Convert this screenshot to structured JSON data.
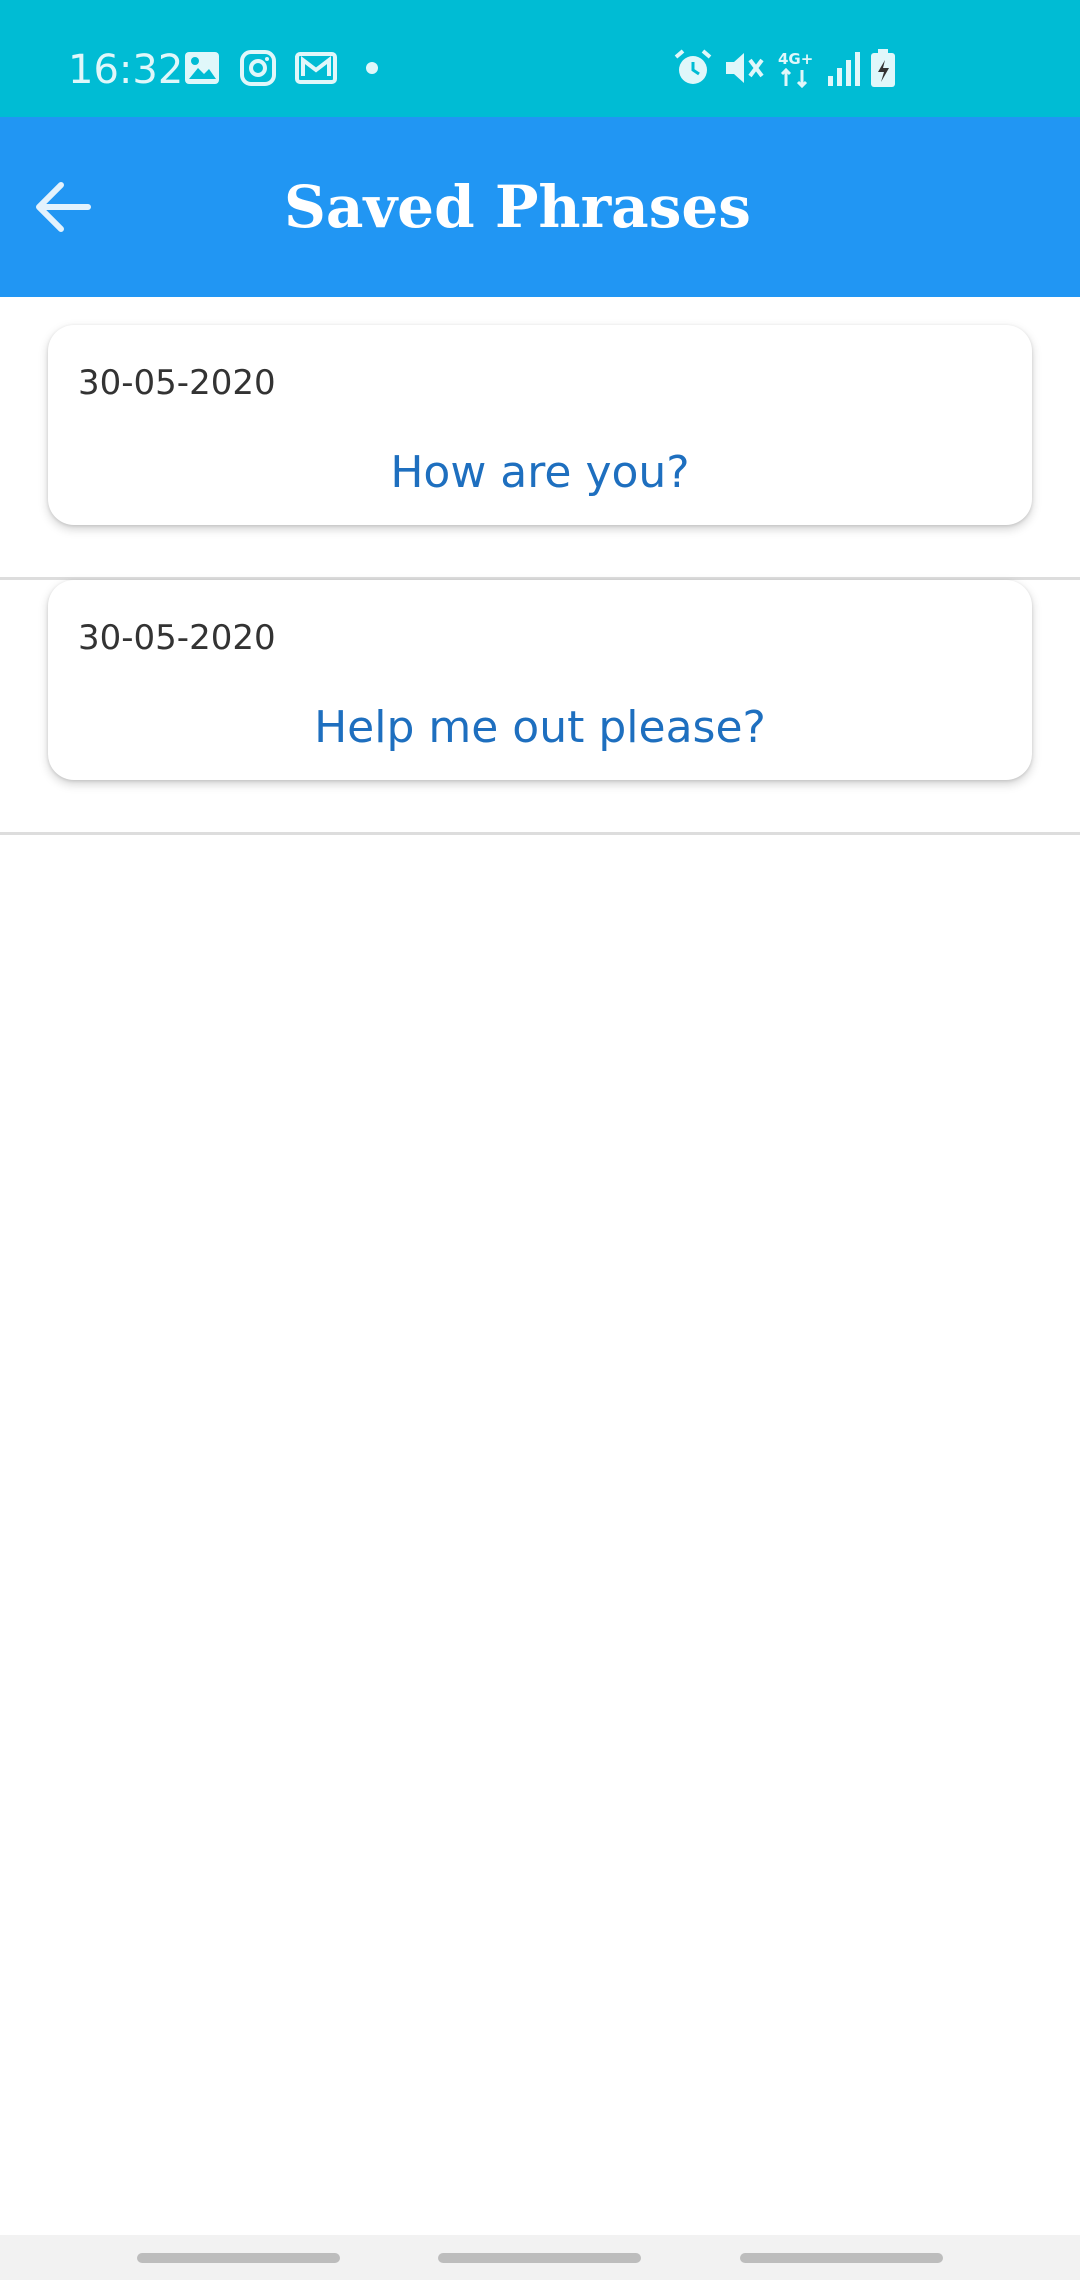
{
  "status_bar": {
    "time": "16:32",
    "left_icons": [
      "gallery-icon",
      "instagram-icon",
      "mail-icon",
      "dot-icon"
    ],
    "right_icons": [
      "alarm-icon",
      "mute-icon",
      "network-4g-icon",
      "signal-icon",
      "battery-icon"
    ],
    "network_label": "4G+",
    "color": "#00BCD4"
  },
  "app_bar": {
    "title": "Saved Phrases",
    "back_icon": "arrow-back-icon",
    "color": "#2196F3"
  },
  "phrases": [
    {
      "date": "30-05-2020",
      "text": "How are you?"
    },
    {
      "date": "30-05-2020",
      "text": "Help me out please?"
    }
  ],
  "colors": {
    "phrase_text": "#1E6FBF",
    "date_text": "#333333",
    "divider": "#DDDDDD"
  }
}
